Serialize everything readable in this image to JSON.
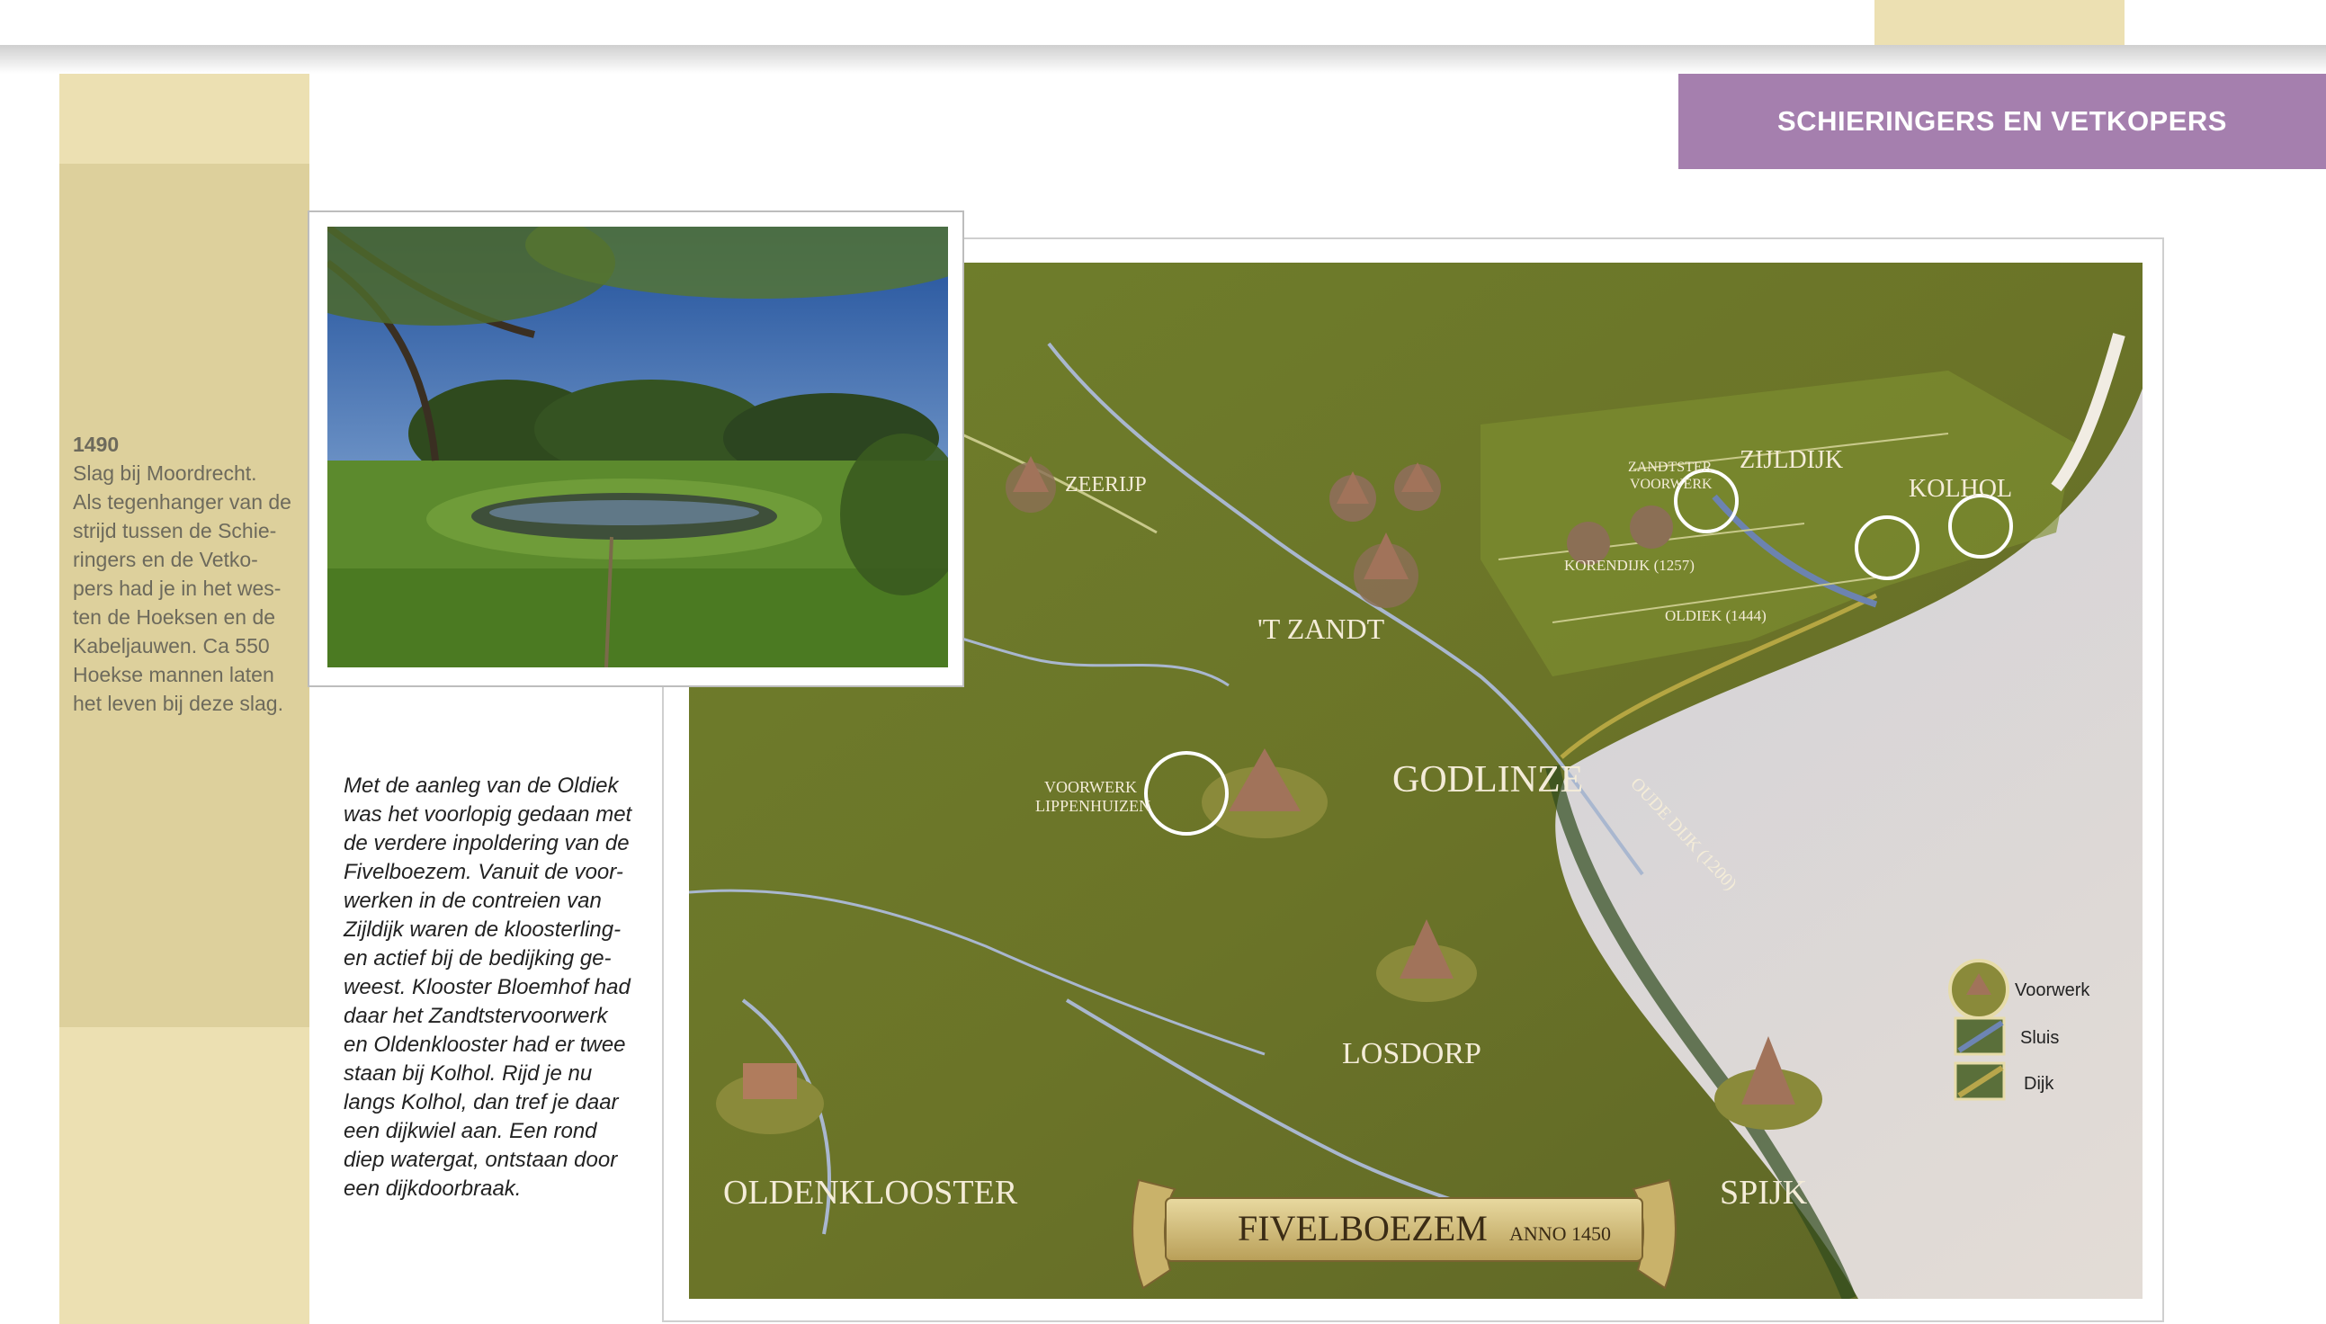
{
  "section_title": "SCHIERINGERS EN VETKOPERS",
  "sidebar": {
    "year": "1490",
    "lines": [
      "Slag bij Moordrecht.",
      "Als tegenhanger van de",
      "strijd tussen de Schie-",
      "ringers en de Vetko-",
      "pers had je in het wes-",
      "ten de Hoeksen en de",
      "Kabeljauwen. Ca 550",
      "Hoekse mannen laten",
      "het leven bij deze slag."
    ]
  },
  "body_text": {
    "lines": [
      "Met de aanleg van de Oldiek",
      "was het voorlopig gedaan met",
      "de verdere inpoldering van de",
      "Fivelboezem. Vanuit de voor-",
      "werken in de contreien van",
      "Zijldijk waren de kloosterling-",
      "en actief bij de bedijking ge-",
      "weest. Klooster Bloemhof had",
      "daar het Zandtstervoorwerk",
      "en Oldenklooster had er twee",
      "staan bij Kolhol. Rijd je nu",
      "langs Kolhol, dan tref je daar",
      "een dijkwiel aan. Een rond",
      "diep watergat, ontstaan door",
      "een dijkdoorbraak."
    ]
  },
  "map": {
    "labels": {
      "zeerijp": "ZEERIJP",
      "zandtster_1": "ZANDTSTER",
      "zandtster_2": "VOORWERK",
      "zijldijk": "ZIJLDIJK",
      "kolhol": "KOLHOL",
      "korendijk": "KORENDIJK (1257)",
      "oldiek": "OLDIEK (1444)",
      "t_zandt": "'T ZANDT",
      "voorwerk_1": "VOORWERK",
      "voorwerk_2": "LIPPENHUIZEN",
      "godlinze": "GODLINZE",
      "oude_dijk": "OUDE DIJK (1200)",
      "losdorp": "LOSDORP",
      "oldenklooster": "OLDENKLOOSTER",
      "spijk": "SPIJK"
    },
    "banner": {
      "title": "FIVELBOEZEM",
      "subtitle": "ANNO 1450"
    },
    "legend": [
      {
        "label": "Voorwerk",
        "icon": "voorwerk-icon"
      },
      {
        "label": "Sluis",
        "icon": "sluis-icon"
      },
      {
        "label": "Dijk",
        "icon": "dijk-icon"
      }
    ]
  },
  "colors": {
    "sidebar": "#ddd09c",
    "sidebar_light": "#ece0b2",
    "header": "#a57fae"
  }
}
